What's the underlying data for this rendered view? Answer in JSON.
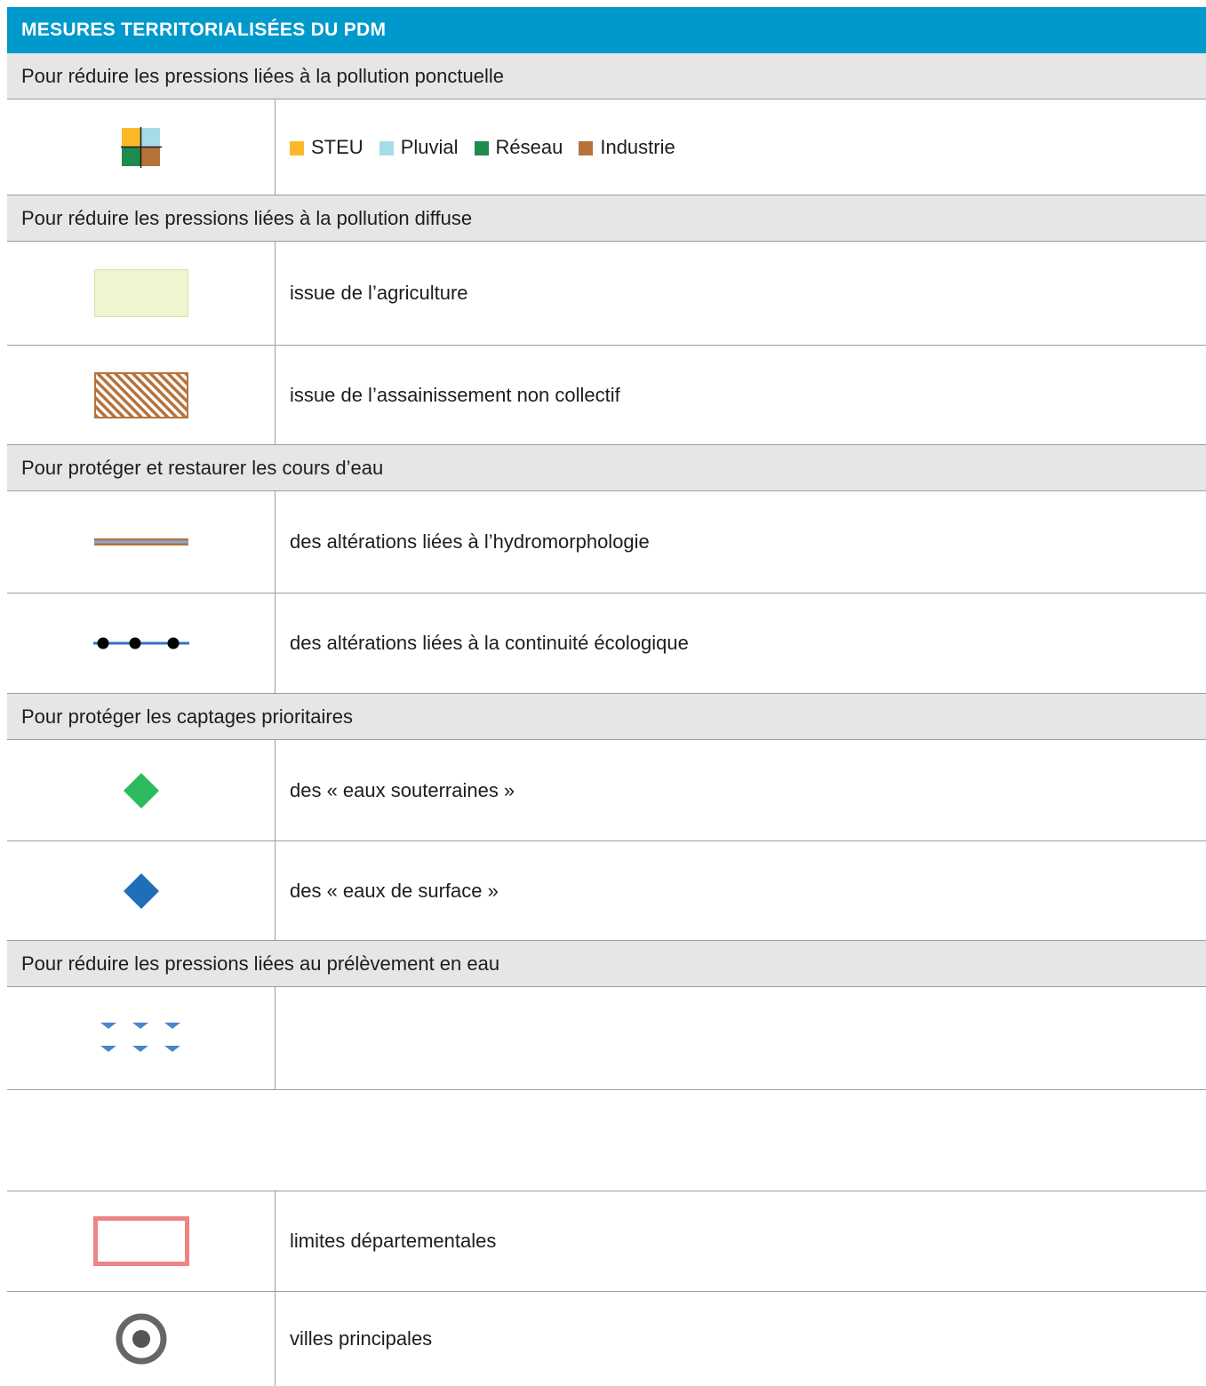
{
  "title": "MESURES TERRITORIALISÉES DU PDM",
  "sections": {
    "ponctuelle": "Pour réduire les pressions liées à la pollution ponctuelle",
    "diffuse": "Pour réduire les pressions liées à la pollution diffuse",
    "cours_eau": "Pour protéger et restaurer les cours d’eau",
    "captages": "Pour protéger les captages prioritaires",
    "prelevement": "Pour réduire les pressions liées au prélèvement en eau"
  },
  "ponctuelle_items": [
    {
      "label": "STEU",
      "color": "#fbb829"
    },
    {
      "label": "Pluvial",
      "color": "#a8dbe8"
    },
    {
      "label": "Réseau",
      "color": "#1f8b4c"
    },
    {
      "label": "Industrie",
      "color": "#b5733a"
    }
  ],
  "rows": {
    "agriculture": "issue de l’agriculture",
    "anc": "issue de l’assainissement non collectif",
    "hydromorpho": "des altérations liées à l’hydromorphologie",
    "continuite": "des altérations liées à la continuité écologique",
    "souterraines": "des « eaux souterraines »",
    "surface": "des « eaux de surface »",
    "prelevement": "",
    "limites": "limites départementales",
    "villes": "villes principales"
  },
  "colors": {
    "header": "#0099cc",
    "section_bg": "#e6e6e6",
    "agriculture_fill": "#eef5cf",
    "hatch": "#b5733a",
    "green_diamond": "#2dbb5f",
    "blue_diamond": "#1f6fb8",
    "triangle": "#4a86c8",
    "limit_border": "#ef8384",
    "city": "#666666"
  },
  "icons": {
    "ponctuelle": "four-square-icon",
    "agriculture": "light-green-area-icon",
    "anc": "hatched-area-icon",
    "hydromorpho": "striped-line-icon",
    "continuite": "dotted-line-icon",
    "souterraines": "green-diamond-icon",
    "surface": "blue-diamond-icon",
    "prelevement": "triangle-pattern-icon",
    "limites": "red-border-rectangle-icon",
    "villes": "city-circle-icon"
  }
}
